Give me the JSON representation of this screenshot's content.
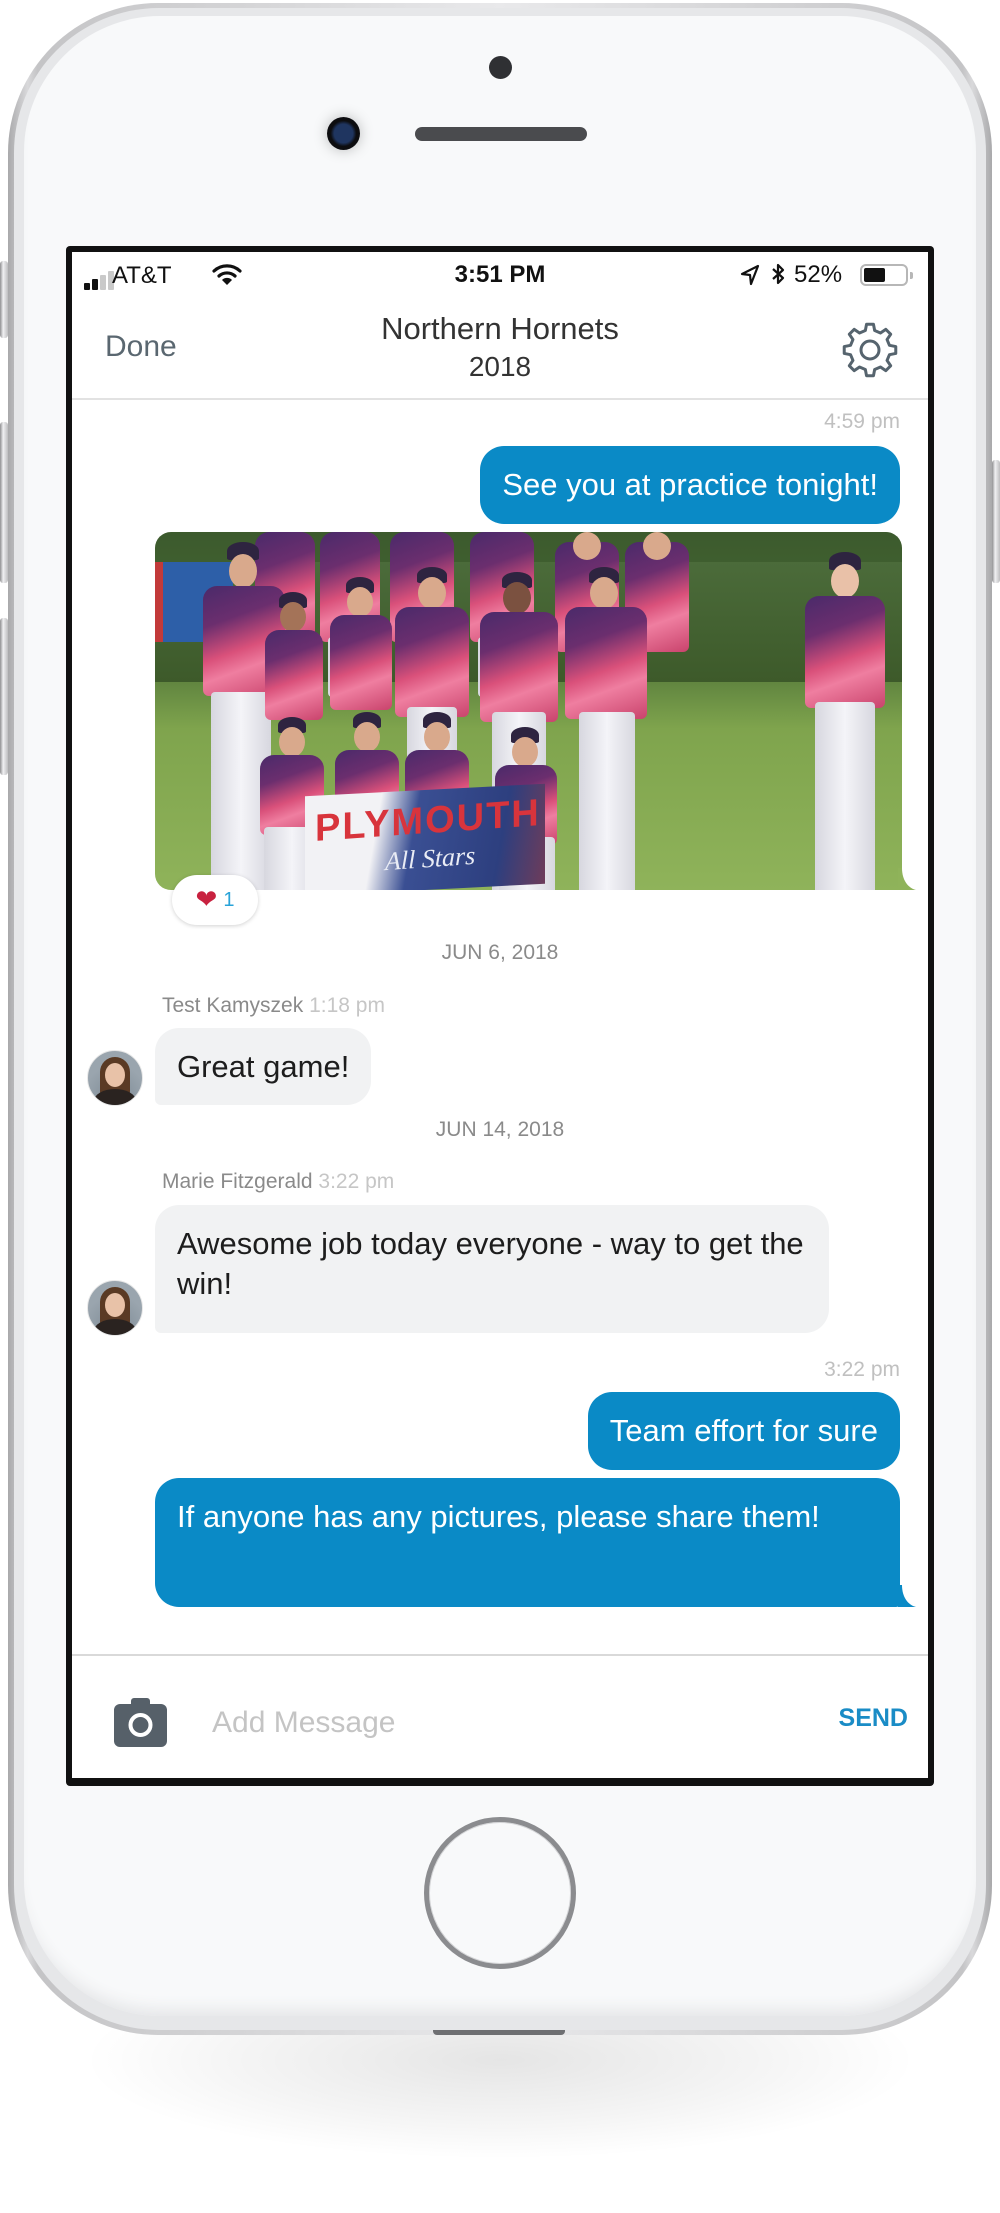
{
  "status_bar": {
    "carrier": "AT&T",
    "signal_bars_filled": 2,
    "signal_bars_total": 4,
    "time": "3:51 PM",
    "battery_percent_label": "52%",
    "battery_level": 0.52,
    "icons": [
      "signal-icon",
      "wifi-icon",
      "location-arrow-icon",
      "bluetooth-icon",
      "battery-icon"
    ]
  },
  "header": {
    "done_label": "Done",
    "title_line1": "Northern Hornets",
    "title_line2": "2018",
    "settings_icon": "gear-icon"
  },
  "messages": [
    {
      "type": "timestamp",
      "text": "4:59 pm"
    },
    {
      "type": "outgoing",
      "text": "See you at practice tonight!"
    },
    {
      "type": "outgoing-photo",
      "description": "Team photo - Plymouth All Stars baseball team",
      "banner_text": "PLYMOUTH",
      "banner_sub": "All Stars",
      "reaction": {
        "icon": "heart-icon",
        "count": "1"
      }
    },
    {
      "type": "date",
      "text": "JUN 6, 2018"
    },
    {
      "type": "incoming",
      "sender": "Test Kamyszek",
      "time": "1:18 pm",
      "text": "Great game!"
    },
    {
      "type": "date",
      "text": "JUN 14, 2018"
    },
    {
      "type": "incoming",
      "sender": "Marie Fitzgerald",
      "time": "3:22 pm",
      "text": "Awesome job today everyone - way to get the win!"
    },
    {
      "type": "timestamp",
      "text": "3:22 pm"
    },
    {
      "type": "outgoing",
      "text": "Team effort for sure"
    },
    {
      "type": "outgoing",
      "text": "If anyone has any pictures, please share them!"
    }
  ],
  "composer": {
    "camera_icon": "camera-icon",
    "placeholder": "Add Message",
    "value": "",
    "send_label": "SEND"
  },
  "colors": {
    "outgoing_bubble": "#0a8ac6",
    "incoming_bubble": "#f1f2f3",
    "send": "#1a8cc6",
    "heart": "#c8213f"
  }
}
